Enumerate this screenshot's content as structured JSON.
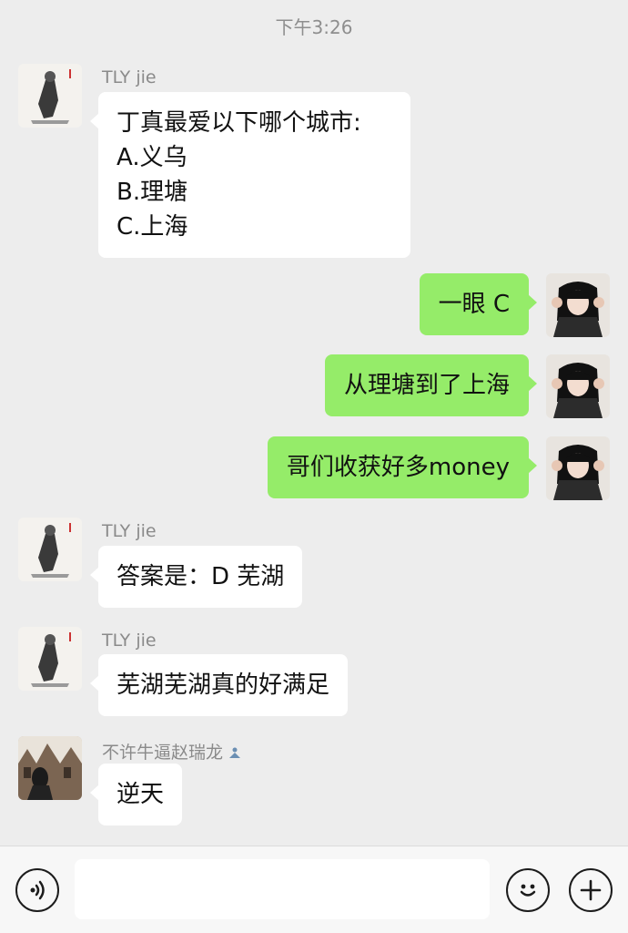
{
  "status": {
    "time": "下午3:26"
  },
  "messages": [
    {
      "sender": "TLY jie",
      "lines": [
        "丁真最爱以下哪个城市:",
        "A.义乌",
        "B.理塘",
        "C.上海"
      ]
    },
    {
      "text": "一眼 C"
    },
    {
      "text": "从理塘到了上海"
    },
    {
      "text": "哥们收获好多money"
    },
    {
      "sender": "TLY jie",
      "text": "答案是：D 芜湖"
    },
    {
      "sender": "TLY jie",
      "text": "芜湖芜湖真的好满足"
    },
    {
      "sender": "不许牛逼赵瑞龙",
      "text": "逆天"
    }
  ],
  "input_bar": {
    "icons": [
      "voice-icon",
      "emoji-icon",
      "plus-icon"
    ],
    "text_value": ""
  }
}
